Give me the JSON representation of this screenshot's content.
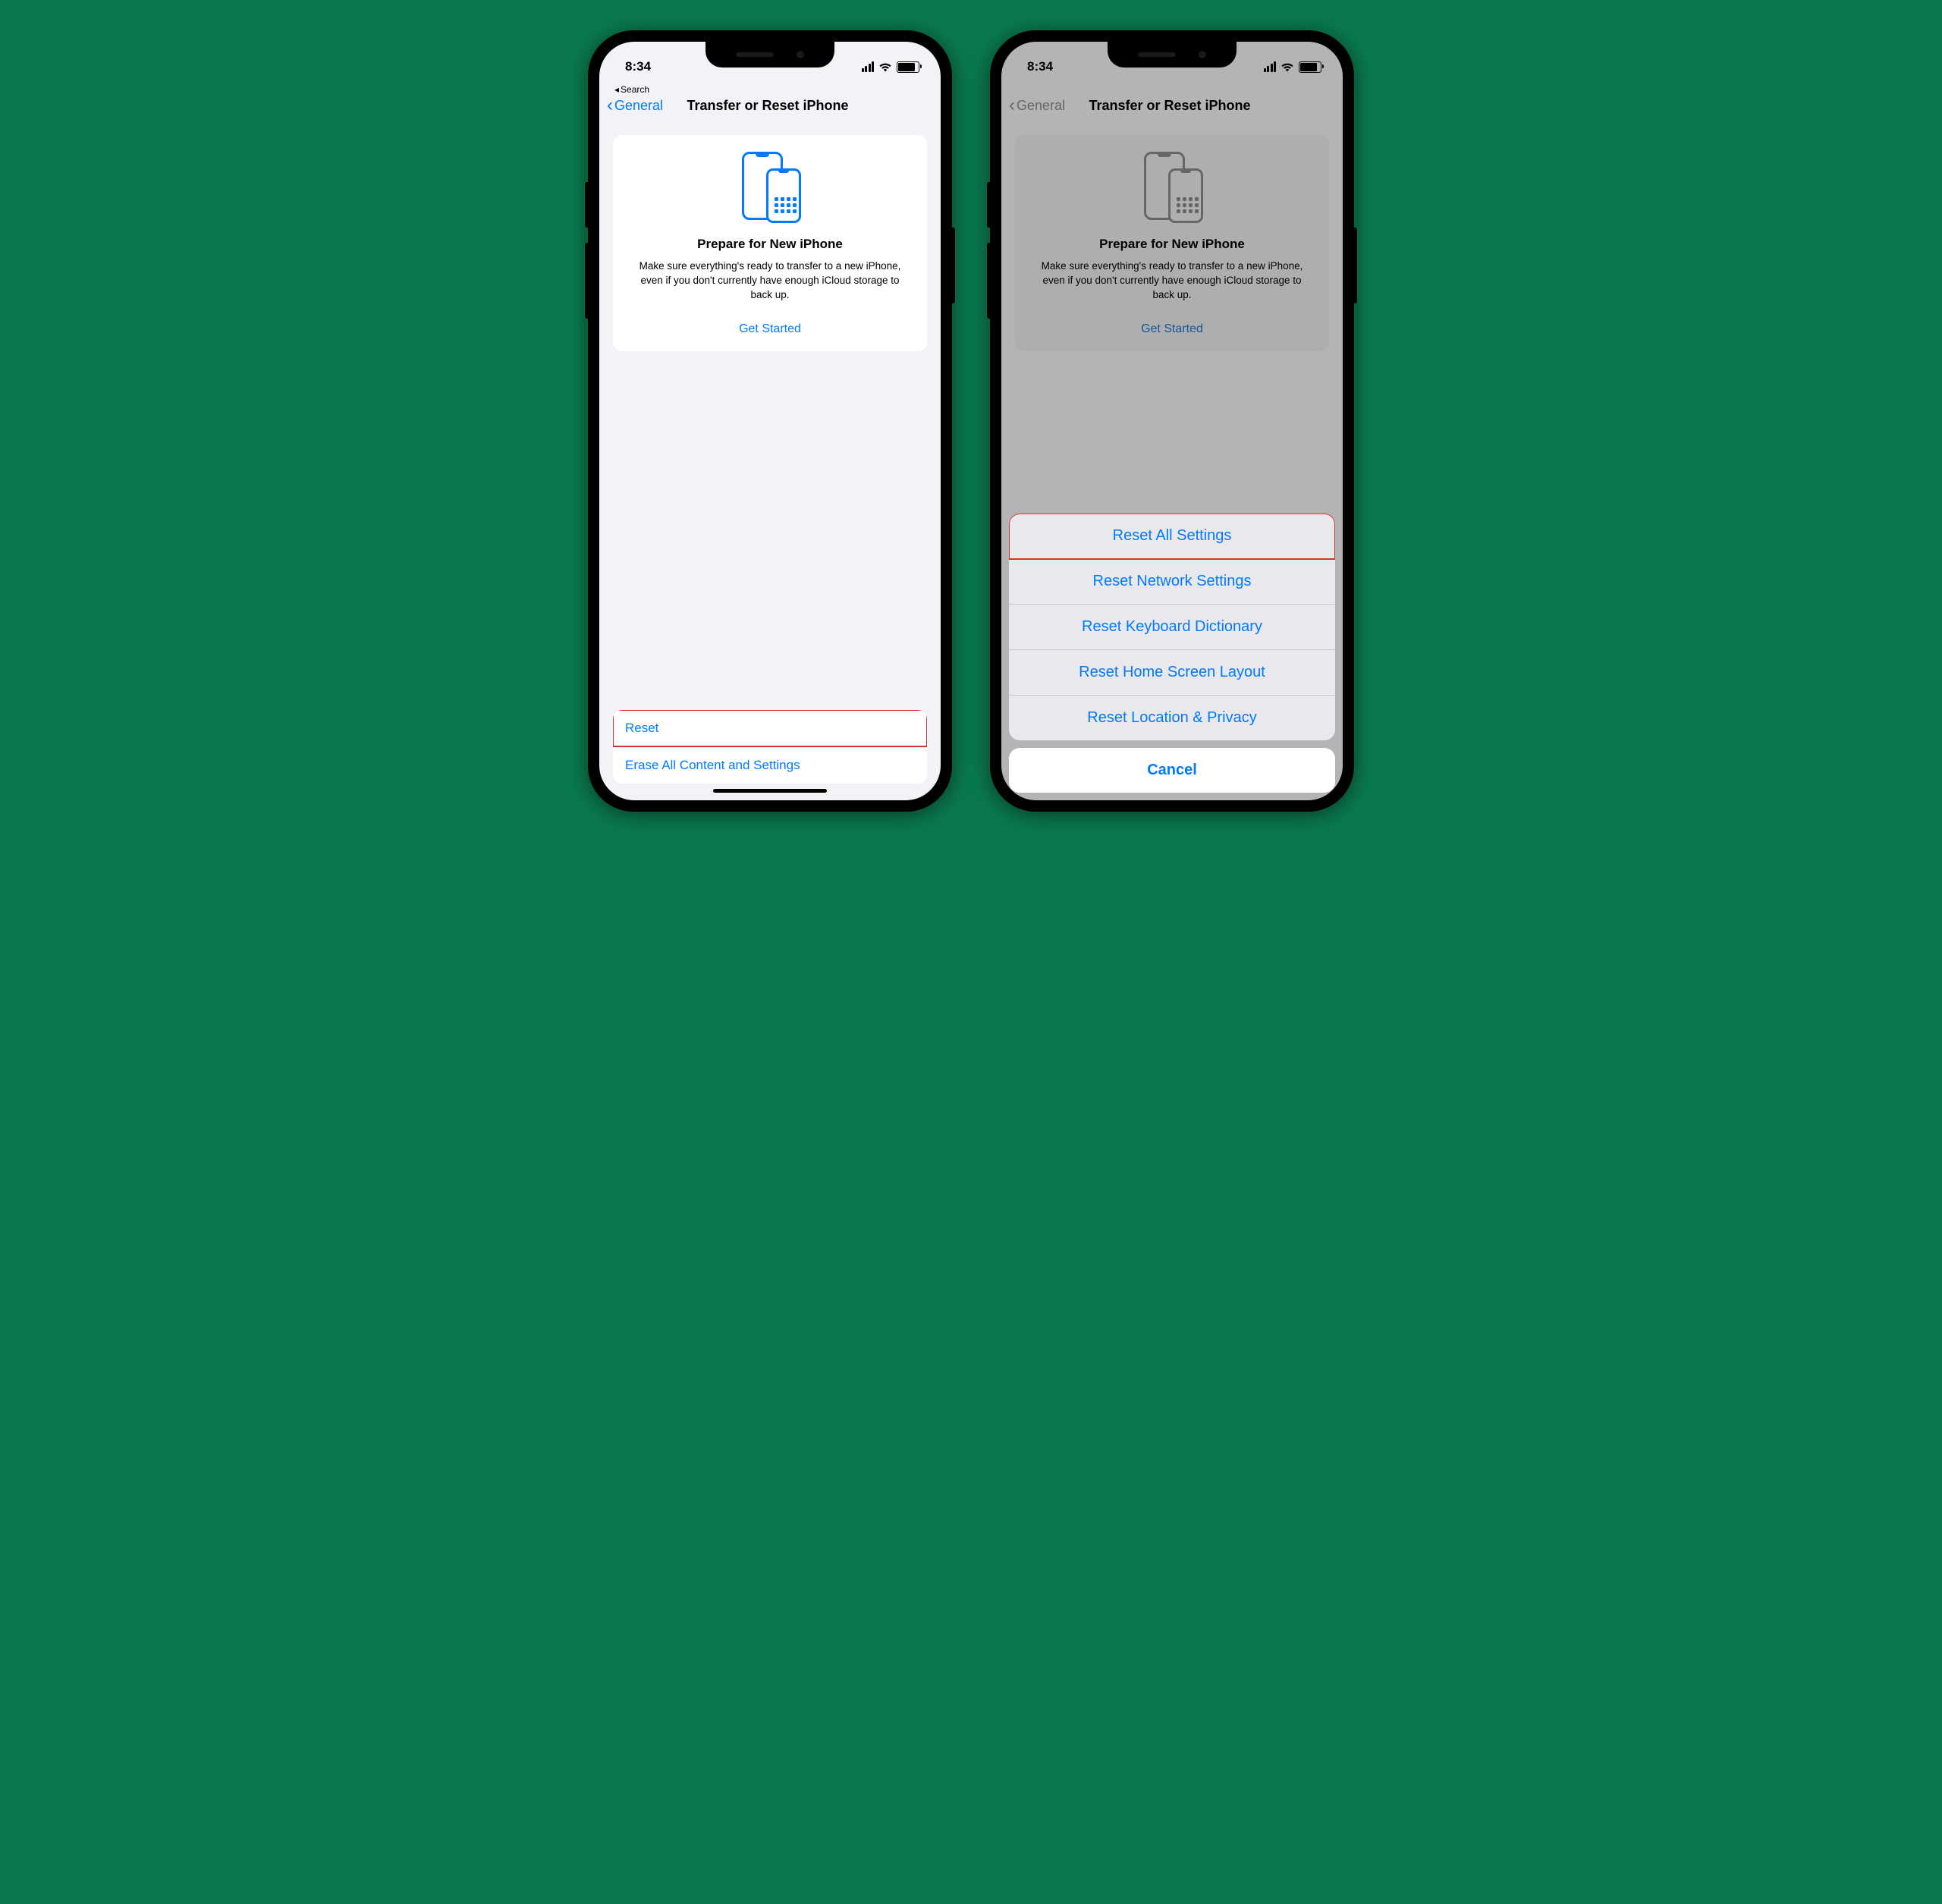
{
  "status": {
    "time": "8:34",
    "crumb": "Search"
  },
  "nav": {
    "back": "General",
    "title": "Transfer or Reset iPhone"
  },
  "card": {
    "heading": "Prepare for New iPhone",
    "body": "Make sure everything's ready to transfer to a new iPhone, even if you don't currently have enough iCloud storage to back up.",
    "cta": "Get Started"
  },
  "bottom": {
    "reset": "Reset",
    "erase": "Erase All Content and Settings"
  },
  "sheet": {
    "options": [
      "Reset All Settings",
      "Reset Network Settings",
      "Reset Keyboard Dictionary",
      "Reset Home Screen Layout",
      "Reset Location & Privacy"
    ],
    "cancel": "Cancel"
  }
}
